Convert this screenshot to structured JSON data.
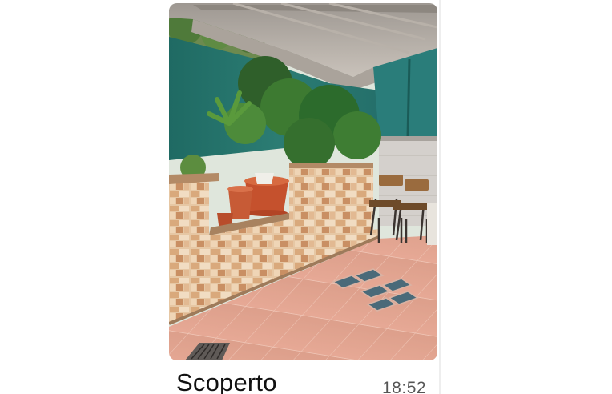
{
  "message": {
    "caption": "Scoperto",
    "time": "18:52",
    "photo_icon": "patio-photo-image"
  },
  "colors": {
    "background": "#ffffff",
    "caption_text": "#111111",
    "time_text": "#555555"
  }
}
